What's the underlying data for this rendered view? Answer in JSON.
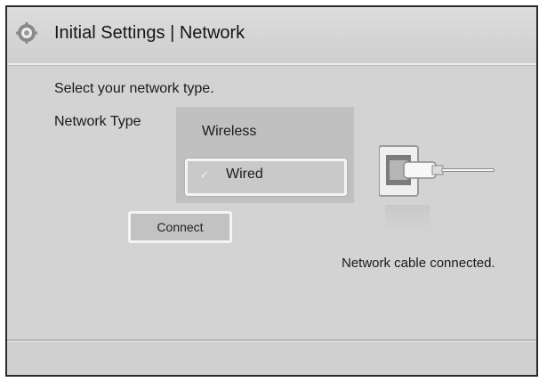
{
  "header": {
    "icon": "gear-icon",
    "title": "Initial Settings | Network"
  },
  "main": {
    "prompt": "Select your network type.",
    "network_type_label": "Network Type",
    "options": [
      {
        "label": "Wireless",
        "selected": false
      },
      {
        "label": "Wired",
        "selected": true,
        "check_glyph": "✓"
      }
    ],
    "connect_button": "Connect",
    "cable_icon": "network-cable-icon",
    "status": "Network cable connected."
  },
  "colors": {
    "background": "#d3d3d3",
    "panel": "#c0c0c0",
    "highlight_border": "#f4f4f4",
    "text": "#1a1a1a"
  }
}
